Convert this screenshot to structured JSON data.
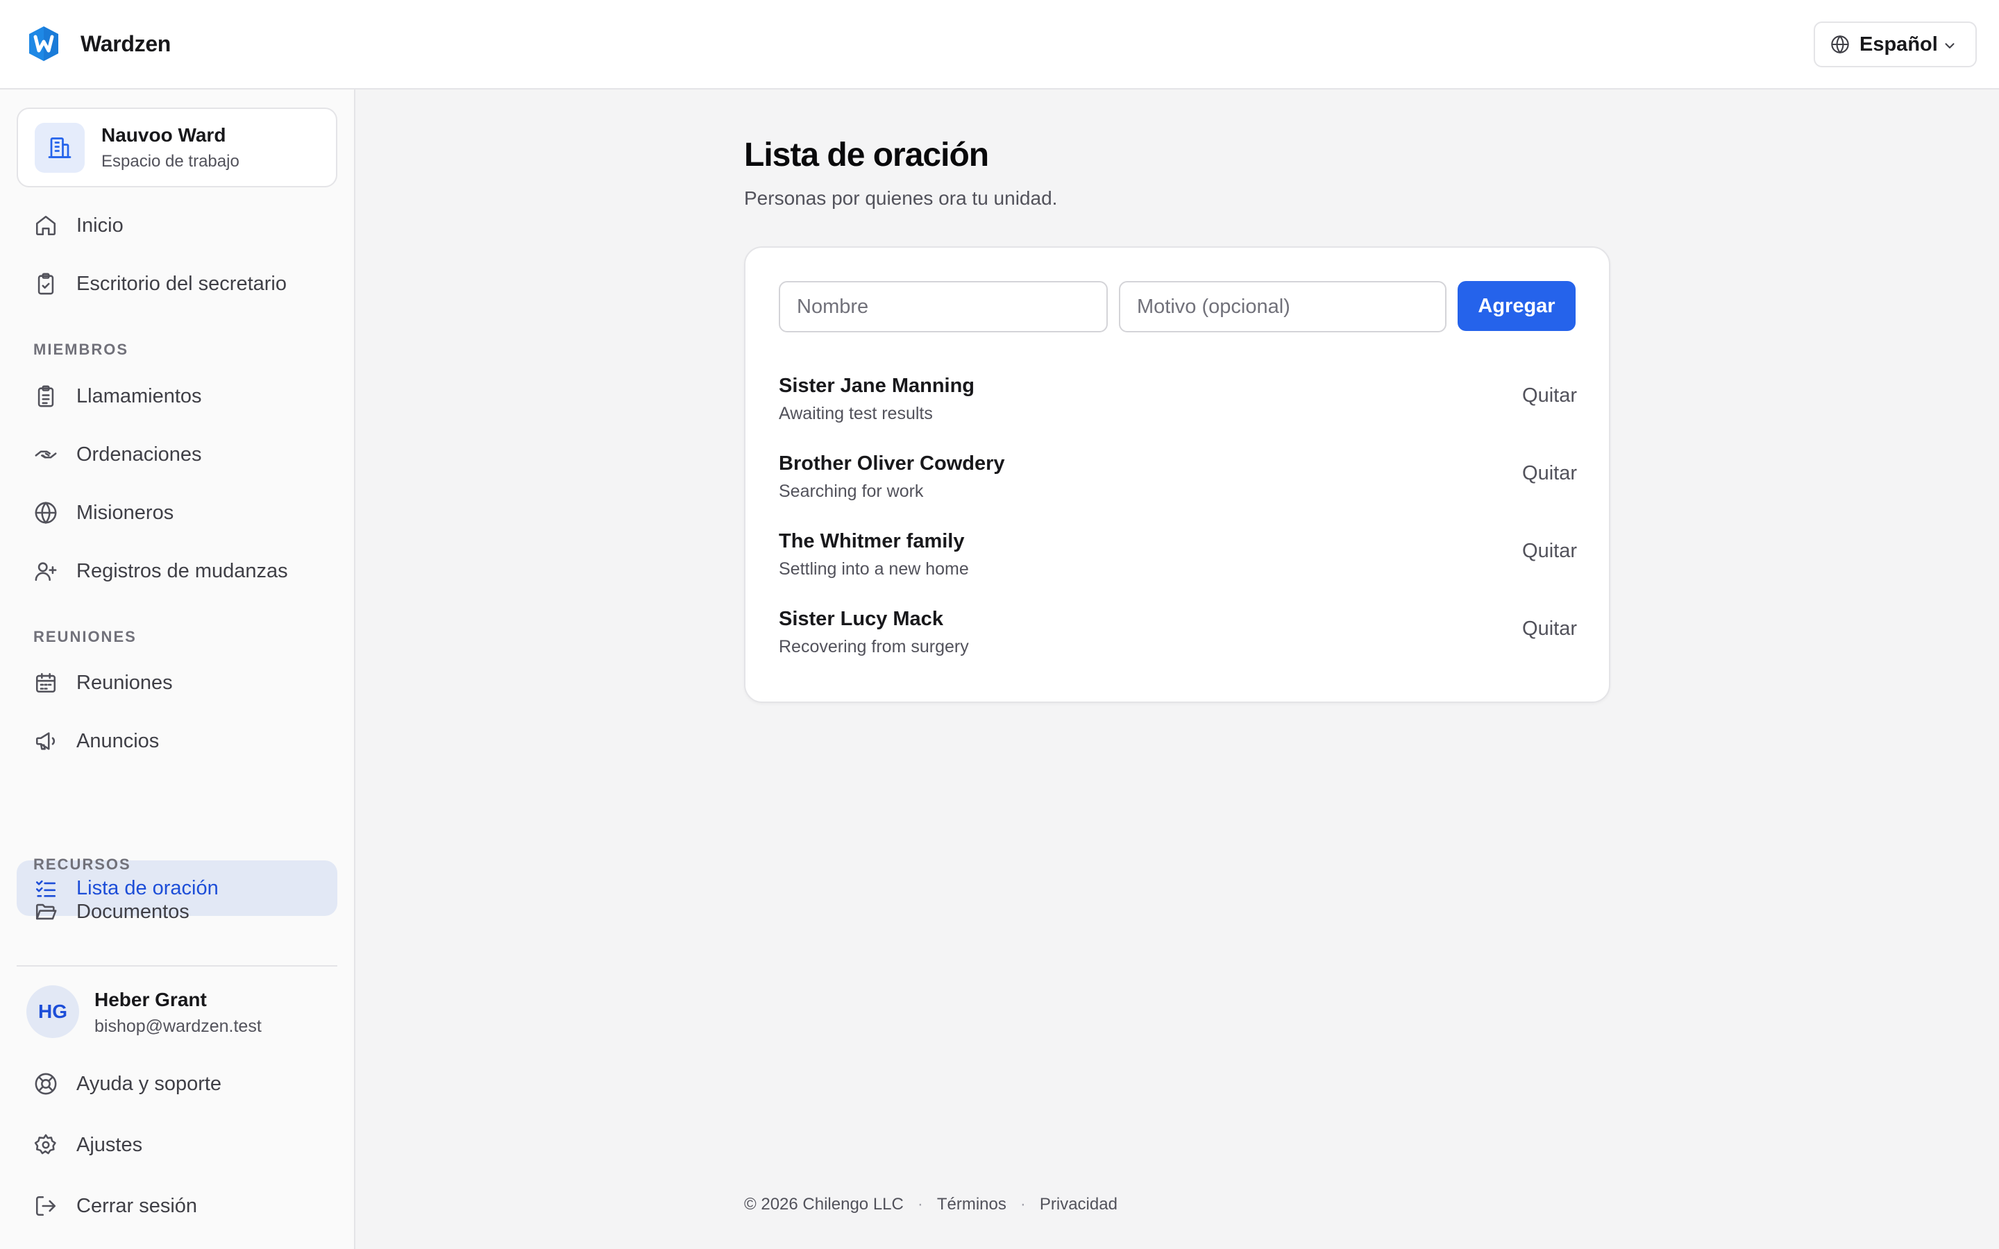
{
  "header": {
    "brand_name": "Wardzen",
    "language_label": "Español"
  },
  "sidebar": {
    "workspace": {
      "title": "Nauvoo Ward",
      "subtitle": "Espacio de trabajo"
    },
    "top_items": [
      {
        "label": "Inicio",
        "icon": "home-icon"
      },
      {
        "label": "Escritorio del secretario",
        "icon": "clipboard-check-icon"
      }
    ],
    "sections": [
      {
        "heading": "MIEMBROS",
        "items": [
          {
            "label": "Llamamientos",
            "icon": "clipboard-list-icon"
          },
          {
            "label": "Ordenaciones",
            "icon": "handshake-icon"
          },
          {
            "label": "Misioneros",
            "icon": "globe-icon"
          },
          {
            "label": "Registros de mudanzas",
            "icon": "user-plus-icon"
          }
        ]
      },
      {
        "heading": "REUNIONES",
        "items": [
          {
            "label": "Reuniones",
            "icon": "calendar-icon"
          },
          {
            "label": "Anuncios",
            "icon": "megaphone-icon"
          },
          {
            "label": "Lista de oración",
            "icon": "list-checks-icon",
            "active": true
          }
        ]
      },
      {
        "heading": "RECURSOS",
        "items": [
          {
            "label": "Documentos",
            "icon": "folder-open-icon"
          }
        ]
      }
    ],
    "user": {
      "initials": "HG",
      "name": "Heber Grant",
      "email": "bishop@wardzen.test"
    },
    "bottom_items": [
      {
        "label": "Ayuda y soporte",
        "icon": "life-buoy-icon"
      },
      {
        "label": "Ajustes",
        "icon": "gear-icon"
      },
      {
        "label": "Cerrar sesión",
        "icon": "log-out-icon"
      }
    ]
  },
  "main": {
    "title": "Lista de oración",
    "subtitle": "Personas por quienes ora tu unidad.",
    "form": {
      "name_placeholder": "Nombre",
      "reason_placeholder": "Motivo (opcional)",
      "add_label": "Agregar"
    },
    "entries": [
      {
        "name": "Sister Jane Manning",
        "reason": "Awaiting test results",
        "remove_label": "Quitar"
      },
      {
        "name": "Brother Oliver Cowdery",
        "reason": "Searching for work",
        "remove_label": "Quitar"
      },
      {
        "name": "The Whitmer family",
        "reason": "Settling into a new home",
        "remove_label": "Quitar"
      },
      {
        "name": "Sister Lucy Mack",
        "reason": "Recovering from surgery",
        "remove_label": "Quitar"
      }
    ]
  },
  "footer": {
    "copyright": "© 2026 Chilengo LLC",
    "separator": "·",
    "terms": "Términos",
    "privacy": "Privacidad"
  },
  "colors": {
    "accent": "#2563eb",
    "active_bg": "#e2e8f5",
    "active_text": "#1d4ed8",
    "logo": "#1e88e5"
  }
}
